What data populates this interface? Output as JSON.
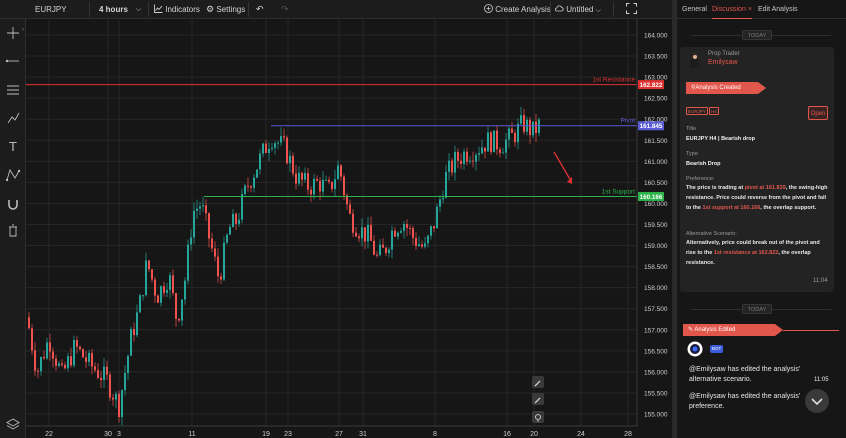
{
  "topbar": {
    "symbol": "EURJPY",
    "interval": "4 hours",
    "indicators": "Indicators",
    "settings": "Settings",
    "create_analysis": "Create Analysis",
    "untitled": "Untitled"
  },
  "chart_data": {
    "type": "candlestick",
    "price_axis": {
      "ticks": [
        "164.000",
        "163.500",
        "163.000",
        "162.500",
        "162.000",
        "161.500",
        "161.000",
        "160.500",
        "160.000",
        "159.500",
        "159.000",
        "158.500",
        "158.000",
        "157.500",
        "157.000",
        "156.500",
        "156.000",
        "155.500",
        "155.000"
      ],
      "range": [
        154.7,
        164.2
      ]
    },
    "time_axis": {
      "ticks": [
        "22",
        "30",
        "3",
        "11",
        "19",
        "23",
        "27",
        "31",
        "8",
        "16",
        "20",
        "24",
        "28"
      ]
    },
    "levels": [
      {
        "label": "1st Resistance",
        "value": "162.822",
        "color": "#e03131"
      },
      {
        "label": "Pivot",
        "value": "161.845",
        "color": "#5b5bd6"
      },
      {
        "label": "1st Support",
        "value": "160.166",
        "color": "#2db34a"
      }
    ],
    "arrow_annotation": {
      "color": "#e03131",
      "direction": "down"
    },
    "colors": {
      "up": "#26a69a",
      "down": "#ef5350"
    }
  },
  "panel": {
    "tabs": [
      "General",
      "Discussion",
      "Edit Analysis"
    ],
    "close": "×",
    "date_pill": "TODAY",
    "author_role": "Prop Trader",
    "author_name": "Emilysaw",
    "created_tag": "Analysis Created",
    "tags": [
      "EURJPY",
      "H4"
    ],
    "open_label": "Open",
    "title_label": "Title",
    "title_value": "EURJPY H4 | Bearish drop",
    "type_label": "Type",
    "type_value": "Bearish Drop",
    "preference_label": "Preference:",
    "pref": {
      "p1": "The price is trading at ",
      "h1": "pivot at 161.839",
      "p2": ", the swing-high resistance. Price could reverse from the pivot and fall to the ",
      "h2": "1st support at 160.166",
      "p3": ", the overlap support."
    },
    "alternative_label": "Alternative Scenario:",
    "alt": {
      "p1": "Alternatively, price could break out of the pivot and rise to the ",
      "h1": "1st resistance at 162.822",
      "p2": ", the overlap resistance."
    },
    "card_time": "11:04",
    "edited_tag": "Analysis Edited",
    "bot_badge": "BOT",
    "msg1": "@Emilysaw  has edited the analysis' alternative scenario.",
    "msg1_time": "11:05",
    "msg2": "@Emilysaw  has edited the analysis' preference."
  },
  "accent": "#e2574c"
}
